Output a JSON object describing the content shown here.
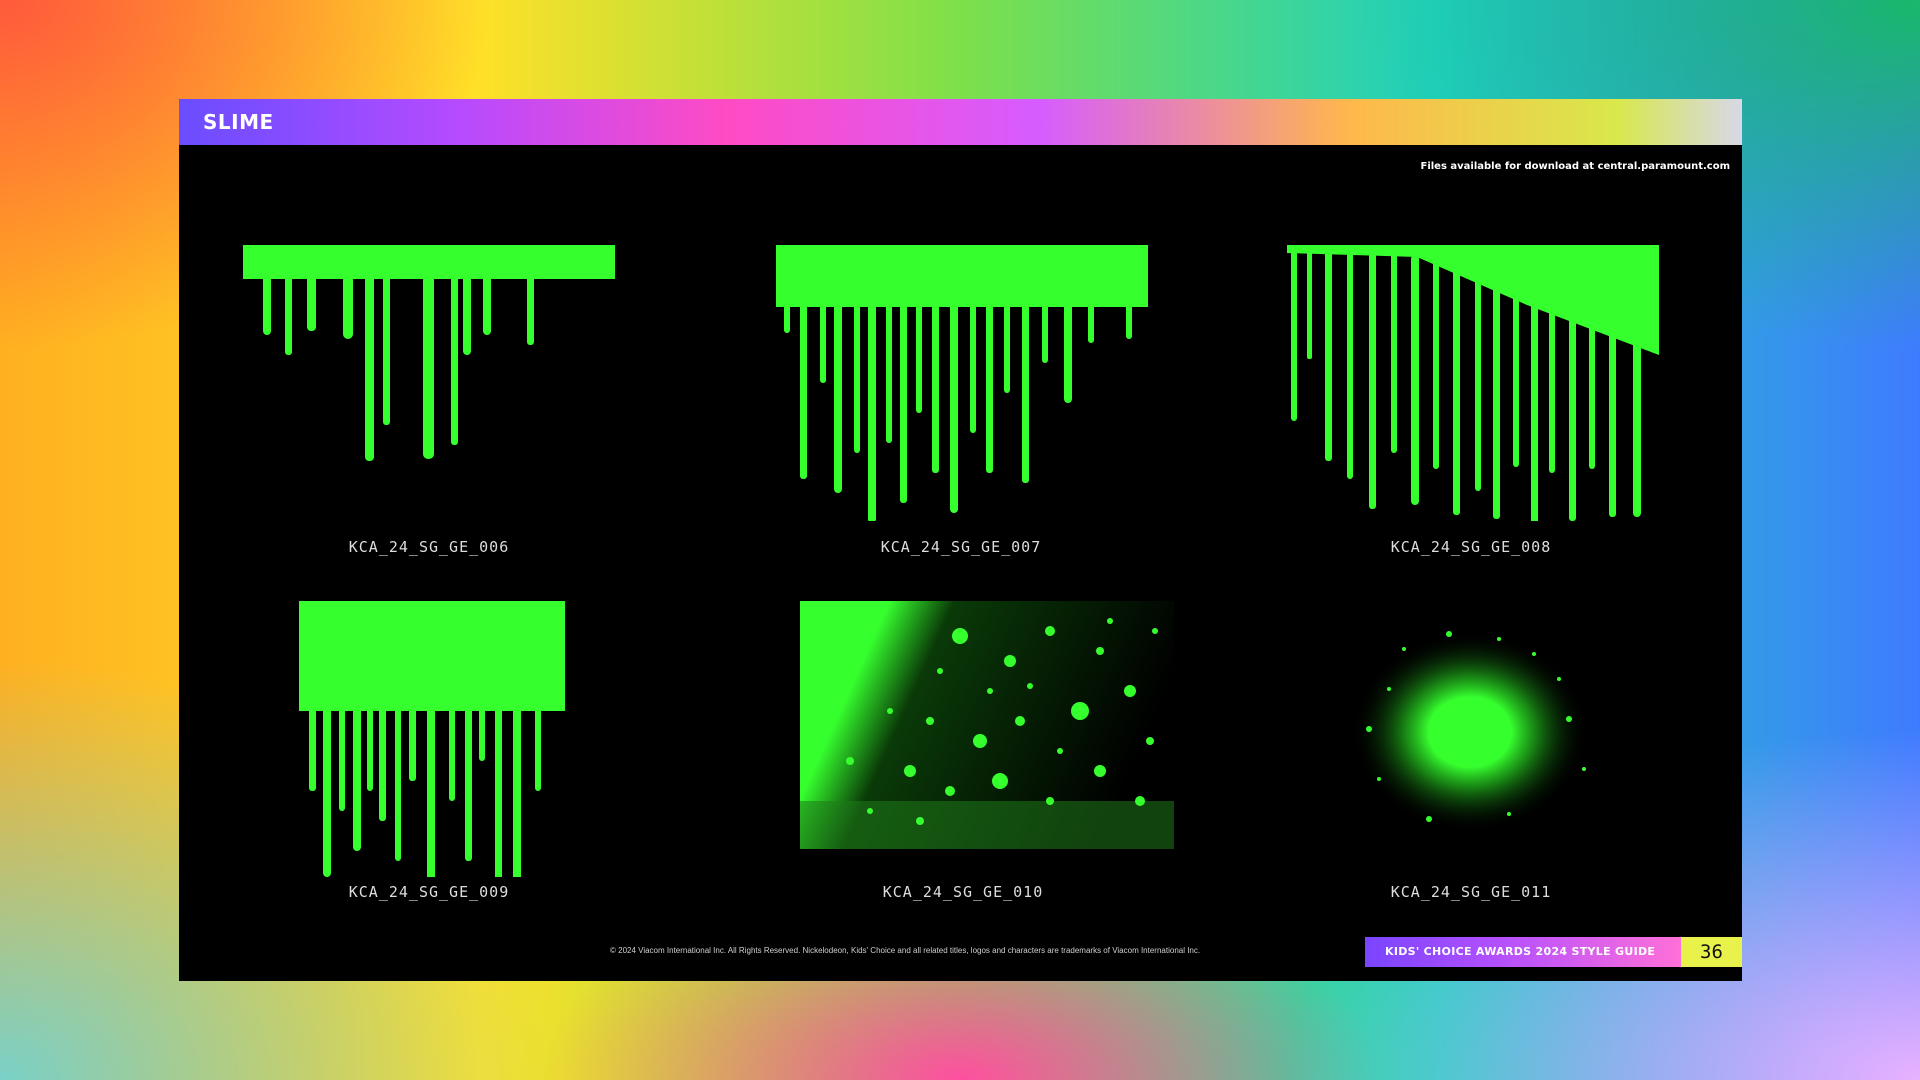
{
  "section_title": "SLIME",
  "download_note": "Files available for download at central.paramount.com",
  "assets": [
    {
      "label": "KCA_24_SG_GE_006"
    },
    {
      "label": "KCA_24_SG_GE_007"
    },
    {
      "label": "KCA_24_SG_GE_008"
    },
    {
      "label": "KCA_24_SG_GE_009"
    },
    {
      "label": "KCA_24_SG_GE_010"
    },
    {
      "label": "KCA_24_SG_GE_011"
    }
  ],
  "footer": {
    "copyright": "© 2024 Viacom International Inc. All Rights Reserved. Nickelodeon, Kids' Choice and all related titles, logos and characters are trademarks of Viacom International Inc.",
    "guide_title": "KIDS' CHOICE AWARDS 2024 STYLE GUIDE",
    "page_number": "36"
  },
  "colors": {
    "slime_green": "#36ff2e",
    "slide_background": "#000000",
    "page_badge": "#e9f24a"
  }
}
